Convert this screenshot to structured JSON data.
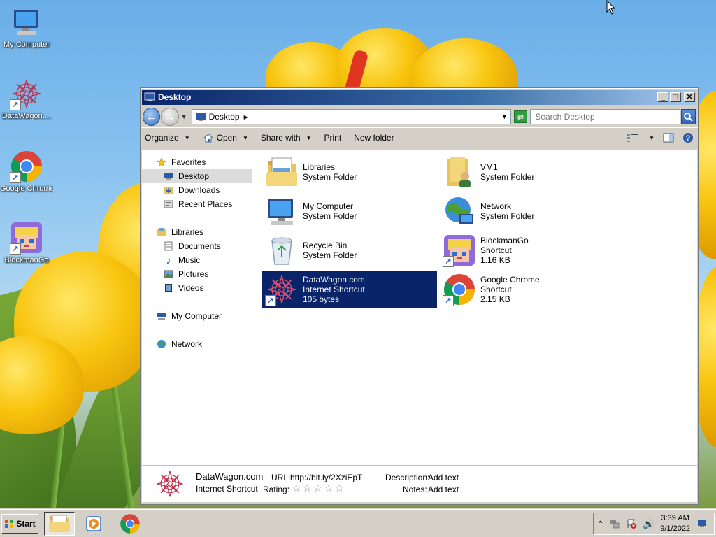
{
  "desktop": {
    "icons": [
      {
        "label": "My Computer"
      },
      {
        "label": "DataWagon...."
      },
      {
        "label": "Google Chrome"
      },
      {
        "label": "BlockmanGo"
      }
    ]
  },
  "window": {
    "title": "Desktop",
    "address": {
      "crumb": "Desktop"
    },
    "search": {
      "placeholder": "Search Desktop"
    },
    "toolbar": {
      "organize": "Organize",
      "open": "Open",
      "share_with": "Share with",
      "print": "Print",
      "new_folder": "New folder"
    },
    "nav": {
      "favorites": "Favorites",
      "desktop": "Desktop",
      "downloads": "Downloads",
      "recent_places": "Recent Places",
      "libraries": "Libraries",
      "documents": "Documents",
      "music": "Music",
      "pictures": "Pictures",
      "videos": "Videos",
      "my_computer": "My Computer",
      "network": "Network"
    },
    "items": [
      {
        "name": "Libraries",
        "type": "System Folder",
        "size": ""
      },
      {
        "name": "VM1",
        "type": "System Folder",
        "size": ""
      },
      {
        "name": "My Computer",
        "type": "System Folder",
        "size": ""
      },
      {
        "name": "Network",
        "type": "System Folder",
        "size": ""
      },
      {
        "name": "Recycle Bin",
        "type": "System Folder",
        "size": ""
      },
      {
        "name": "BlockmanGo",
        "type": "Shortcut",
        "size": "1.16 KB"
      },
      {
        "name": "DataWagon.com",
        "type": "Internet Shortcut",
        "size": "105 bytes"
      },
      {
        "name": "Google Chrome",
        "type": "Shortcut",
        "size": "2.15 KB"
      }
    ],
    "details": {
      "name": "DataWagon.com",
      "type": "Internet Shortcut",
      "url_label": "URL:",
      "url_value": "http://bit.ly/2XziEpT",
      "rating_label": "Rating:",
      "rating_stars": "☆☆☆☆☆",
      "description_label": "Description:",
      "description_value": "Add text",
      "notes_label": "Notes:",
      "notes_value": "Add text"
    }
  },
  "taskbar": {
    "start_label": "Start",
    "time": "3:39 AM",
    "date": "9/1/2022"
  },
  "colors": {
    "selection": "#0a246a",
    "title_start": "#0a246a",
    "title_end": "#a6caf0",
    "chrome_red": "#db4437",
    "chrome_green": "#0f9d58",
    "chrome_yellow": "#f4b400",
    "chrome_blue": "#4285f4"
  }
}
